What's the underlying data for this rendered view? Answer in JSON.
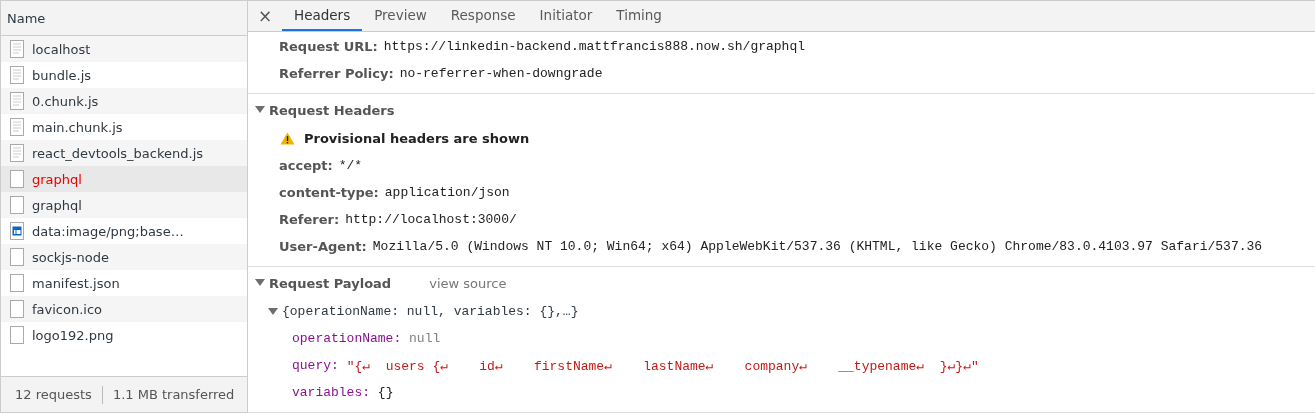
{
  "requests_panel": {
    "column": "Name",
    "requests": [
      {
        "name": "localhost",
        "kind": "document",
        "selected": false,
        "failed": false
      },
      {
        "name": "bundle.js",
        "kind": "document",
        "selected": false,
        "failed": false
      },
      {
        "name": "0.chunk.js",
        "kind": "document",
        "selected": false,
        "failed": false
      },
      {
        "name": "main.chunk.js",
        "kind": "document",
        "selected": false,
        "failed": false
      },
      {
        "name": "react_devtools_backend.js",
        "kind": "document",
        "selected": false,
        "failed": false
      },
      {
        "name": "graphql",
        "kind": "blank",
        "selected": true,
        "failed": true
      },
      {
        "name": "graphql",
        "kind": "blank",
        "selected": false,
        "failed": false
      },
      {
        "name": "data:image/png;base…",
        "kind": "image",
        "selected": false,
        "failed": false
      },
      {
        "name": "sockjs-node",
        "kind": "blank",
        "selected": false,
        "failed": false
      },
      {
        "name": "manifest.json",
        "kind": "blank",
        "selected": false,
        "failed": false
      },
      {
        "name": "favicon.ico",
        "kind": "blank",
        "selected": false,
        "failed": false
      },
      {
        "name": "logo192.png",
        "kind": "blank",
        "selected": false,
        "failed": false
      }
    ],
    "status": {
      "requests": "12 requests",
      "transferred": "1.1 MB transferred"
    }
  },
  "detail_panel": {
    "close": "×",
    "tabs": [
      {
        "label": "Headers",
        "selected": true
      },
      {
        "label": "Preview",
        "selected": false
      },
      {
        "label": "Response",
        "selected": false
      },
      {
        "label": "Initiator",
        "selected": false
      },
      {
        "label": "Timing",
        "selected": false
      }
    ],
    "general": [
      {
        "key": "Request URL:",
        "value": "https://linkedin-backend.mattfrancis888.now.sh/graphql"
      },
      {
        "key": "Referrer Policy:",
        "value": "no-referrer-when-downgrade"
      }
    ],
    "request_headers": {
      "title": "Request Headers",
      "expanded": true,
      "warning": "Provisional headers are shown",
      "rows": [
        {
          "key": "accept:",
          "value": "*/*"
        },
        {
          "key": "content-type:",
          "value": "application/json"
        },
        {
          "key": "Referer:",
          "value": "http://localhost:3000/"
        },
        {
          "key": "User-Agent:",
          "value": "Mozilla/5.0 (Windows NT 10.0; Win64; x64) AppleWebKit/537.36 (KHTML, like Gecko) Chrome/83.0.4103.97 Safari/537.36"
        }
      ]
    },
    "request_payload": {
      "title": "Request Payload",
      "expanded": true,
      "link": "view source",
      "summary": "{operationName: null, variables: {},…}",
      "summary_expanded": true,
      "properties": [
        {
          "key": "operationName:",
          "value": "null",
          "kind": "null"
        },
        {
          "key": "query:",
          "value": "\"{↵  users {↵    id↵    firstName↵    lastName↵    company↵    __typename↵  }↵}↵\"",
          "kind": "string"
        },
        {
          "key": "variables:",
          "value": "{}",
          "kind": "object"
        }
      ]
    }
  }
}
